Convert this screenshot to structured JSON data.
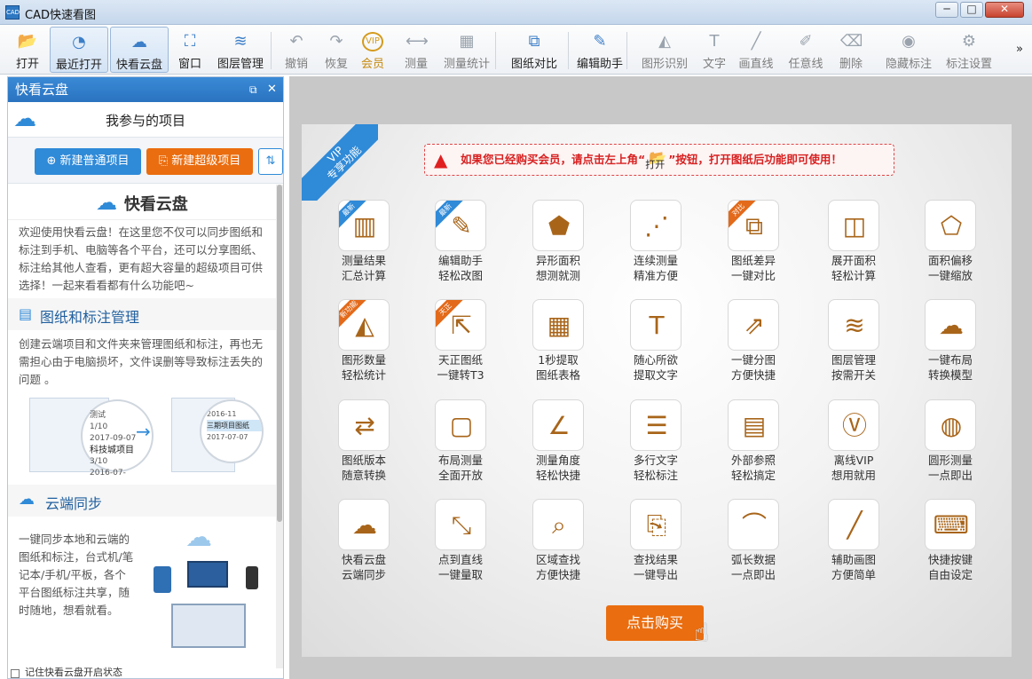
{
  "window": {
    "title": "CAD快速看图",
    "app_icon": "CAD",
    "minimize": "─",
    "maximize": "□",
    "close": "✕"
  },
  "toolbar": {
    "items": [
      {
        "label": "打开",
        "icon": "open-folder-icon",
        "glyph": "📂",
        "state": "normal"
      },
      {
        "label": "最近打开",
        "icon": "clock-icon",
        "glyph": "◔",
        "state": "active"
      },
      {
        "label": "快看云盘",
        "icon": "cloud-icon",
        "glyph": "☁",
        "state": "active"
      },
      {
        "label": "窗口",
        "icon": "window-icon",
        "glyph": "⛶",
        "state": "normal"
      },
      {
        "label": "图层管理",
        "icon": "layers-icon",
        "glyph": "≋",
        "state": "normal"
      },
      {
        "label": "撤销",
        "icon": "undo-icon",
        "glyph": "↶",
        "state": "disabled"
      },
      {
        "label": "恢复",
        "icon": "redo-icon",
        "glyph": "↷",
        "state": "disabled"
      },
      {
        "label": "会员",
        "icon": "vip-icon",
        "glyph": "VIP",
        "state": "vip"
      },
      {
        "label": "测量",
        "icon": "ruler-icon",
        "glyph": "⟷",
        "state": "disabled"
      },
      {
        "label": "测量统计",
        "icon": "measure-stats-icon",
        "glyph": "▦",
        "state": "disabled"
      },
      {
        "label": "图纸对比",
        "icon": "compare-icon",
        "glyph": "⧉",
        "state": "normal"
      },
      {
        "label": "编辑助手",
        "icon": "edit-assistant-icon",
        "glyph": "✎",
        "state": "normal"
      },
      {
        "label": "图形识别",
        "icon": "shape-recognize-icon",
        "glyph": "◭",
        "state": "disabled"
      },
      {
        "label": "文字",
        "icon": "text-icon",
        "glyph": "T",
        "state": "disabled"
      },
      {
        "label": "画直线",
        "icon": "line-icon",
        "glyph": "╱",
        "state": "disabled"
      },
      {
        "label": "任意线",
        "icon": "pen-icon",
        "glyph": "✐",
        "state": "disabled"
      },
      {
        "label": "删除",
        "icon": "eraser-icon",
        "glyph": "⌫",
        "state": "disabled"
      },
      {
        "label": "隐藏标注",
        "icon": "eye-hide-icon",
        "glyph": "◉",
        "state": "disabled"
      },
      {
        "label": "标注设置",
        "icon": "annotation-settings-icon",
        "glyph": "⚙",
        "state": "disabled"
      }
    ],
    "overflow": "»"
  },
  "panel": {
    "title": "快看云盘",
    "restore": "⧉",
    "close": "✕",
    "project_label": "我参与的项目",
    "new_normal": "新建普通项目",
    "new_super": "新建超级项目",
    "sync_glyph": "⇅",
    "brand": "快看云盘",
    "intro": "欢迎使用快看云盘！在这里您不仅可以同步图纸和标注到手机、电脑等各个平台，还可以分享图纸、标注给其他人查看，更有超大容量的超级项目可供选择！一起来看看都有什么功能吧~",
    "sec1_title": "图纸和标注管理",
    "sec1_text": "创建云端项目和文件夹来管理图纸和标注，再也无需担心由于电脑损坏，文件误删等导致标注丢失的问题 。",
    "sec1_img": {
      "left_a": "测试",
      "left_b": "1/10",
      "left_c": "2017-09-07",
      "left_d": "科技城项目",
      "left_e": "3/10",
      "left_f": "2016-07-",
      "right_a": "2016-11",
      "right_b": "三期项目图纸",
      "right_c": "2017-07-07"
    },
    "sec2_title": "云端同步",
    "sec2_text": "一键同步本地和云端的图纸和标注，台式机/笔记本/手机/平板，各个平台图纸标注共享，随时随地，想看就看。",
    "footer": "记住快看云盘开启状态"
  },
  "vip": {
    "ribbon": "VIP\n专享功能",
    "notice_a": "如果您已经购买会员，请点击左上角“",
    "notice_open": "打开",
    "notice_b": "”按钮，打开图纸后功能即可使用！",
    "buy": "点击购买",
    "features": [
      {
        "l1": "测量结果",
        "l2": "汇总计算",
        "tag": "最新",
        "tag_color": "#2f8ad8",
        "icon": "measure-summary-icon",
        "glyph": "▥"
      },
      {
        "l1": "编辑助手",
        "l2": "轻松改图",
        "tag": "最新",
        "tag_color": "#2f8ad8",
        "icon": "cad-edit-icon",
        "glyph": "✎"
      },
      {
        "l1": "异形面积",
        "l2": "想测就测",
        "tag": "",
        "icon": "irregular-area-icon",
        "glyph": "⬟"
      },
      {
        "l1": "连续测量",
        "l2": "精准方便",
        "tag": "",
        "icon": "continuous-measure-icon",
        "glyph": "⋰"
      },
      {
        "l1": "图纸差异",
        "l2": "一键对比",
        "tag": "对比",
        "tag_color": "#e36a1a",
        "icon": "diff-icon",
        "glyph": "⧉"
      },
      {
        "l1": "展开面积",
        "l2": "轻松计算",
        "tag": "",
        "icon": "unfold-area-icon",
        "glyph": "◫"
      },
      {
        "l1": "面积偏移",
        "l2": "一键缩放",
        "tag": "",
        "icon": "area-offset-icon",
        "glyph": "⬠"
      },
      {
        "l1": "图形数量",
        "l2": "轻松统计",
        "tag": "新功能",
        "tag_color": "#e36a1a",
        "icon": "shape-count-icon",
        "glyph": "◭"
      },
      {
        "l1": "天正图纸",
        "l2": "一键转T3",
        "tag": "天正",
        "tag_color": "#e36a1a",
        "icon": "tangent-convert-icon",
        "glyph": "⇱"
      },
      {
        "l1": "1秒提取",
        "l2": "图纸表格",
        "tag": "",
        "icon": "table-extract-icon",
        "glyph": "▦"
      },
      {
        "l1": "随心所欲",
        "l2": "提取文字",
        "tag": "",
        "icon": "text-extract-icon",
        "glyph": "T"
      },
      {
        "l1": "一键分图",
        "l2": "方便快捷",
        "tag": "",
        "icon": "split-drawing-icon",
        "glyph": "⇗"
      },
      {
        "l1": "图层管理",
        "l2": "按需开关",
        "tag": "",
        "icon": "layer-toggle-icon",
        "glyph": "≋"
      },
      {
        "l1": "一键布局",
        "l2": "转换模型",
        "tag": "",
        "icon": "layout-convert-icon",
        "glyph": "☁"
      },
      {
        "l1": "图纸版本",
        "l2": "随意转换",
        "tag": "",
        "icon": "version-convert-icon",
        "glyph": "⇄"
      },
      {
        "l1": "布局测量",
        "l2": "全面开放",
        "tag": "",
        "icon": "layout-measure-icon",
        "glyph": "▢"
      },
      {
        "l1": "测量角度",
        "l2": "轻松快捷",
        "tag": "",
        "icon": "angle-icon",
        "glyph": "∠"
      },
      {
        "l1": "多行文字",
        "l2": "轻松标注",
        "tag": "",
        "icon": "multiline-text-icon",
        "glyph": "☰"
      },
      {
        "l1": "外部参照",
        "l2": "轻松搞定",
        "tag": "",
        "icon": "xref-icon",
        "glyph": "▤"
      },
      {
        "l1": "离线VIP",
        "l2": "想用就用",
        "tag": "",
        "icon": "offline-vip-icon",
        "glyph": "Ⓥ"
      },
      {
        "l1": "圆形测量",
        "l2": "一点即出",
        "tag": "",
        "icon": "circle-measure-icon",
        "glyph": "◍"
      },
      {
        "l1": "快看云盘",
        "l2": "云端同步",
        "tag": "",
        "icon": "cloud-sync-icon",
        "glyph": "☁"
      },
      {
        "l1": "点到直线",
        "l2": "一键量取",
        "tag": "",
        "icon": "point-line-icon",
        "glyph": "⤡"
      },
      {
        "l1": "区域查找",
        "l2": "方便快捷",
        "tag": "",
        "icon": "area-search-icon",
        "glyph": "⌕"
      },
      {
        "l1": "查找结果",
        "l2": "一键导出",
        "tag": "",
        "icon": "export-icon",
        "glyph": "⎘"
      },
      {
        "l1": "弧长数据",
        "l2": "一点即出",
        "tag": "",
        "icon": "arc-length-icon",
        "glyph": "⌒"
      },
      {
        "l1": "辅助画图",
        "l2": "方便简单",
        "tag": "",
        "icon": "draw-assist-icon",
        "glyph": "╱"
      },
      {
        "l1": "快捷按键",
        "l2": "自由设定",
        "tag": "",
        "icon": "shortcut-icon",
        "glyph": "⌨"
      }
    ]
  }
}
